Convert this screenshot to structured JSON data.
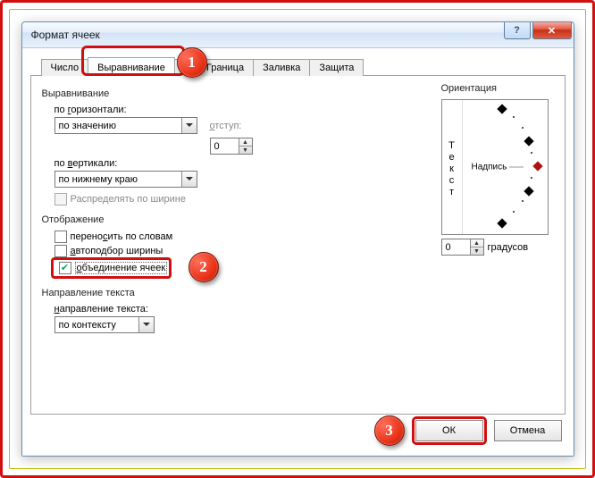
{
  "window": {
    "title": "Формат ячеек"
  },
  "titlebar": {
    "help": "?",
    "close": "✕"
  },
  "tabs": {
    "items": [
      {
        "label": "Число"
      },
      {
        "label": "Выравнивание"
      },
      {
        "label": "т"
      },
      {
        "label": "Граница"
      },
      {
        "label": "Заливка"
      },
      {
        "label": "Защита"
      }
    ],
    "active_index": 1
  },
  "alignment": {
    "group_label": "Выравнивание",
    "horizontal_label": "по горизонтали:",
    "horizontal_value": "по значению",
    "indent_label": "отступ:",
    "indent_value": "0",
    "vertical_label": "по вертикали:",
    "vertical_value": "по нижнему краю",
    "distribute_label": "Распределять по ширине"
  },
  "display": {
    "group_label": "Отображение",
    "wrap_label": "переносить по словам",
    "autofit_label": "автоподбор ширины",
    "merge_label": "объединение ячеек",
    "merge_checked": true
  },
  "direction": {
    "group_label": "Направление текста",
    "text_dir_label": "направление текста:",
    "text_dir_value": "по контексту"
  },
  "orientation": {
    "group_label": "Ориентация",
    "vertical_text": "Текст",
    "horizontal_text": "Надпись",
    "degrees_value": "0",
    "degrees_label": "градусов"
  },
  "buttons": {
    "ok": "ОК",
    "cancel": "Отмена"
  },
  "badges": {
    "b1": "1",
    "b2": "2",
    "b3": "3"
  }
}
